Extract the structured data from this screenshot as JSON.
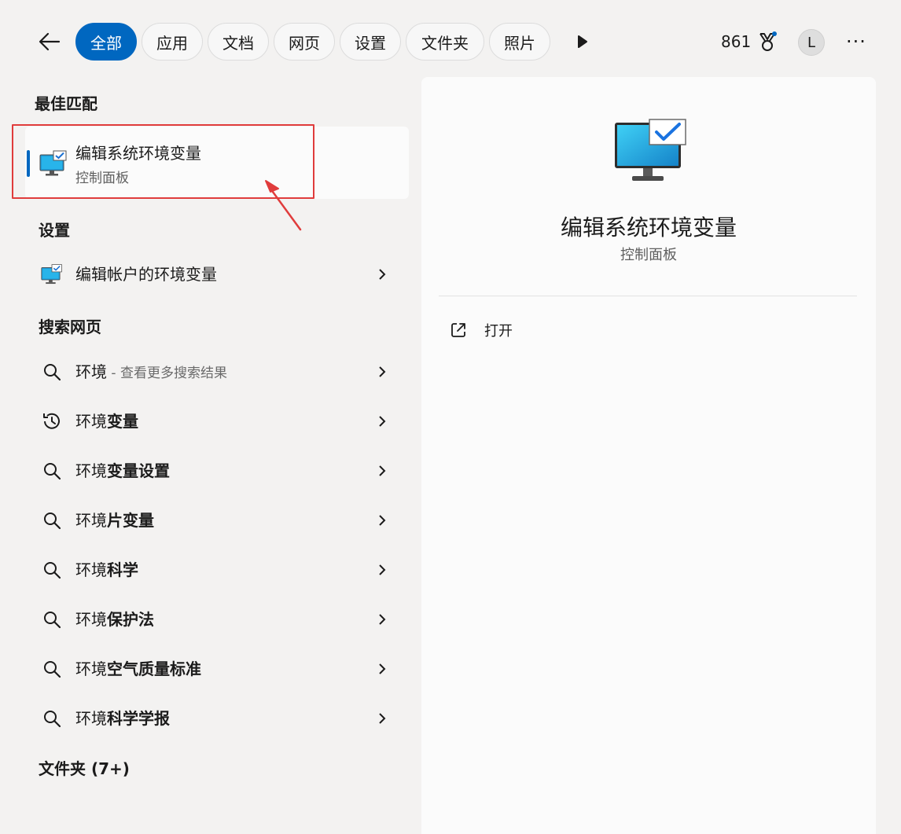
{
  "header": {
    "tabs": [
      {
        "label": "全部",
        "active": true
      },
      {
        "label": "应用"
      },
      {
        "label": "文档"
      },
      {
        "label": "网页"
      },
      {
        "label": "设置"
      },
      {
        "label": "文件夹"
      },
      {
        "label": "照片"
      }
    ],
    "points": "861",
    "avatar_letter": "L",
    "more_label": "···"
  },
  "best_match": {
    "section_title": "最佳匹配",
    "title": "编辑系统环境变量",
    "subtitle": "控制面板"
  },
  "settings": {
    "section_title": "设置",
    "items": [
      {
        "label": "编辑帐户的环境变量"
      }
    ]
  },
  "web_search": {
    "section_title": "搜索网页",
    "items": [
      {
        "prefix": "环境",
        "bold": "",
        "hint": " - 查看更多搜索结果",
        "icon": "search-icon"
      },
      {
        "prefix": "环境",
        "bold": "变量",
        "hint": "",
        "icon": "history-icon"
      },
      {
        "prefix": "环境",
        "bold": "变量设置",
        "hint": "",
        "icon": "search-icon"
      },
      {
        "prefix": "环境",
        "bold": "片变量",
        "hint": "",
        "icon": "search-icon"
      },
      {
        "prefix": "环境",
        "bold": "科学",
        "hint": "",
        "icon": "search-icon"
      },
      {
        "prefix": "环境",
        "bold": "保护法",
        "hint": "",
        "icon": "search-icon"
      },
      {
        "prefix": "环境",
        "bold": "空气质量标准",
        "hint": "",
        "icon": "search-icon"
      },
      {
        "prefix": "环境",
        "bold": "科学学报",
        "hint": "",
        "icon": "search-icon"
      }
    ]
  },
  "folders": {
    "section_title": "文件夹 (7+)"
  },
  "detail": {
    "title": "编辑系统环境变量",
    "subtitle": "控制面板",
    "actions": [
      {
        "label": "打开"
      }
    ]
  },
  "colors": {
    "accent": "#0067c0",
    "highlight_border": "#e03c3c"
  }
}
